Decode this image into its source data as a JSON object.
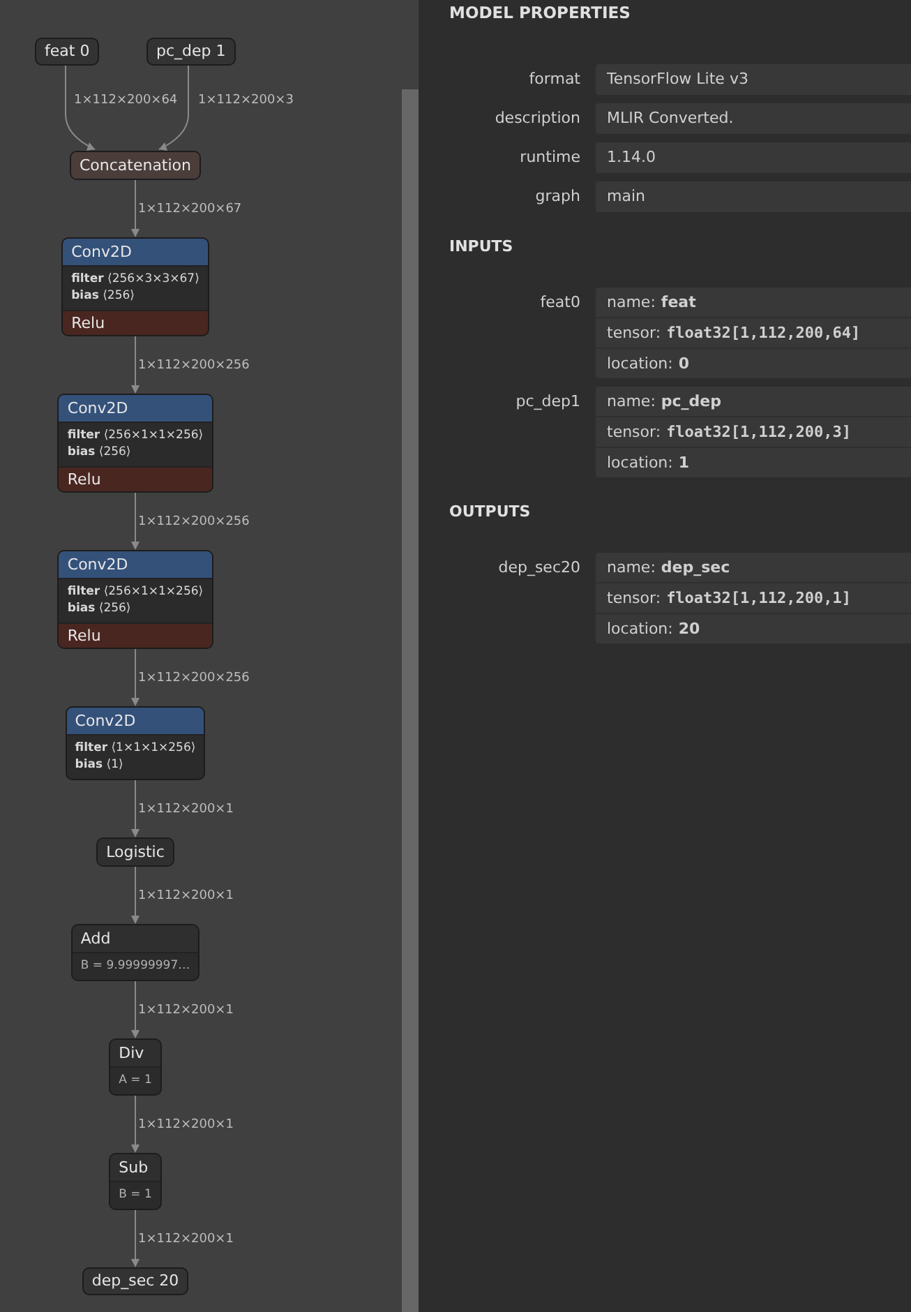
{
  "graph": {
    "inputs": [
      {
        "name": "feat 0",
        "edge_label": "1×112×200×64"
      },
      {
        "name": "pc_dep 1",
        "edge_label": "1×112×200×3"
      }
    ],
    "nodes": [
      {
        "kind": "operator",
        "title": "Concatenation",
        "color": "#4a3d3a",
        "edge_label": "1×112×200×67"
      },
      {
        "kind": "operator",
        "title": "Conv2D",
        "color": "#34517a",
        "attributes": [
          "**filter** ⟨256×3×3×67⟩",
          "**bias** ⟨256⟩"
        ],
        "activation": "Relu",
        "edge_label": "1×112×200×256"
      },
      {
        "kind": "operator",
        "title": "Conv2D",
        "color": "#34517a",
        "attributes": [
          "**filter** ⟨256×1×1×256⟩",
          "**bias** ⟨256⟩"
        ],
        "activation": "Relu",
        "edge_label": "1×112×200×256"
      },
      {
        "kind": "operator",
        "title": "Conv2D",
        "color": "#34517a",
        "attributes": [
          "**filter** ⟨256×1×1×256⟩",
          "**bias** ⟨256⟩"
        ],
        "activation": "Relu",
        "edge_label": "1×112×200×256"
      },
      {
        "kind": "operator",
        "title": "Conv2D",
        "color": "#34517a",
        "attributes": [
          "**filter** ⟨1×1×1×256⟩",
          "**bias** ⟨1⟩"
        ],
        "edge_label": "1×112×200×1"
      },
      {
        "kind": "operator",
        "title": "Logistic",
        "color": "#2f2f2f",
        "edge_label": "1×112×200×1"
      },
      {
        "kind": "operator",
        "title": "Add",
        "color": "#2f2f2f",
        "attributes": [
          "B = 9.99999997…"
        ],
        "edge_label": "1×112×200×1"
      },
      {
        "kind": "operator",
        "title": "Div",
        "color": "#2f2f2f",
        "attributes": [
          "A = 1"
        ],
        "edge_label": "1×112×200×1"
      },
      {
        "kind": "operator",
        "title": "Sub",
        "color": "#2f2f2f",
        "attributes": [
          "B = 1"
        ],
        "edge_label": "1×112×200×1"
      },
      {
        "kind": "output",
        "title": "dep_sec 20"
      }
    ]
  },
  "properties": {
    "title": "MODEL PROPERTIES",
    "items": [
      {
        "label": "format",
        "value": "TensorFlow Lite v3"
      },
      {
        "label": "description",
        "value": "MLIR Converted."
      },
      {
        "label": "runtime",
        "value": "1.14.0"
      },
      {
        "label": "graph",
        "value": "main"
      }
    ],
    "sections": [
      {
        "heading": "INPUTS",
        "groups": [
          {
            "name": "feat0",
            "fields": [
              {
                "label": "name:",
                "value": "feat",
                "kind": "text"
              },
              {
                "label": "tensor:",
                "value": "float32[1,112,200,64]",
                "kind": "code"
              },
              {
                "label": "location:",
                "value": "0",
                "kind": "text"
              }
            ]
          },
          {
            "name": "pc_dep1",
            "fields": [
              {
                "label": "name:",
                "value": "pc_dep",
                "kind": "text"
              },
              {
                "label": "tensor:",
                "value": "float32[1,112,200,3]",
                "kind": "code"
              },
              {
                "label": "location:",
                "value": "1",
                "kind": "text"
              }
            ]
          }
        ]
      },
      {
        "heading": "OUTPUTS",
        "groups": [
          {
            "name": "dep_sec20",
            "fields": [
              {
                "label": "name:",
                "value": "dep_sec",
                "kind": "text"
              },
              {
                "label": "tensor:",
                "value": "float32[1,112,200,1]",
                "kind": "code"
              },
              {
                "label": "location:",
                "value": "20",
                "kind": "text"
              }
            ]
          }
        ]
      }
    ]
  }
}
